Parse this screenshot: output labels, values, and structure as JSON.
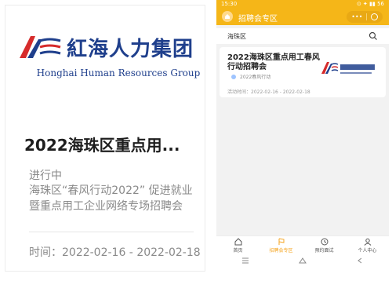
{
  "card": {
    "logo_cn": "紅海人力集团",
    "logo_en": "Honghai Human Resources Group",
    "title": "2022海珠区重点用...",
    "status": "进行中",
    "description": "海珠区“春风行动2022” 促进就业暨重点用工企业网络专场招聘会",
    "time": "时间：2022-02-16 - 2022-02-18"
  },
  "phone": {
    "status_time": "15:30",
    "status_right": "⊙ ✦ ▮▮ 56",
    "nav_title": "招聘会专区",
    "capsule_dots": "•••",
    "search_value": "海珠区",
    "job": {
      "title": "2022海珠区重点用工春风行动招聘会",
      "tag": "2022春风行动",
      "time": "活动时间：2022-02-16 - 2022-02-18"
    },
    "tabs": [
      {
        "label": "首页"
      },
      {
        "label": "招聘会专区"
      },
      {
        "label": "预约面试"
      },
      {
        "label": "个人中心"
      }
    ]
  },
  "colors": {
    "accent": "#f5b618",
    "brand_blue": "#1f3f8c",
    "brand_red": "#d62b2b"
  }
}
